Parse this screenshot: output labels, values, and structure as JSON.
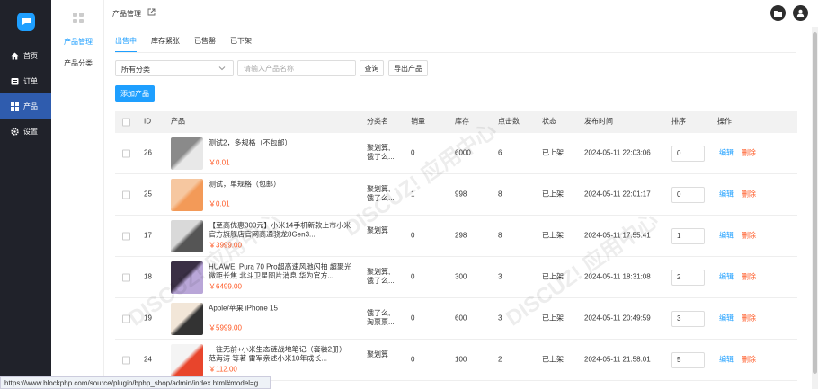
{
  "nav": [
    {
      "label": "首页",
      "icon": "home-icon"
    },
    {
      "label": "订单",
      "icon": "order-icon"
    },
    {
      "label": "产品",
      "icon": "product-icon"
    },
    {
      "label": "设置",
      "icon": "gear-icon"
    }
  ],
  "subnav": [
    "产品管理",
    "产品分类"
  ],
  "header": {
    "title": "产品管理"
  },
  "tabs": [
    "出售中",
    "库存紧张",
    "已售罄",
    "已下架"
  ],
  "filters": {
    "category_select": "所有分类",
    "search_placeholder": "请输入产品名称",
    "query_label": "查询",
    "export_label": "导出产品",
    "add_label": "添加产品"
  },
  "table": {
    "columns": [
      "ID",
      "产品",
      "分类名",
      "销量",
      "库存",
      "点击数",
      "状态",
      "发布时间",
      "排序",
      "操作"
    ],
    "rows": [
      {
        "id": "26",
        "name": "测试2，多规格（不包邮）",
        "price": "￥0.01",
        "category": "聚划算, 饿了么...",
        "sales": "0",
        "stock": "6000",
        "clicks": "6",
        "status": "已上架",
        "time": "2024-05-11 22:03:06",
        "sort": "0"
      },
      {
        "id": "25",
        "name": "测试，单规格（包邮）",
        "price": "￥0.01",
        "category": "聚划算, 饿了么...",
        "sales": "1",
        "stock": "998",
        "clicks": "8",
        "status": "已上架",
        "time": "2024-05-11 22:01:17",
        "sort": "0"
      },
      {
        "id": "17",
        "name": "【至高优惠300元】小米14手机新款上市小米官方旗舰店官网高通骁龙8Gen3...",
        "price": "￥3999.00",
        "category": "聚划算",
        "sales": "0",
        "stock": "298",
        "clicks": "8",
        "status": "已上架",
        "time": "2024-05-11 17:55:41",
        "sort": "1"
      },
      {
        "id": "18",
        "name": "HUAWEI Pura 70 Pro超高速风驰闪拍 超聚光微距长焦 北斗卫星图片消息 华为官方...",
        "price": "￥6499.00",
        "category": "聚划算, 饿了么...",
        "sales": "0",
        "stock": "300",
        "clicks": "3",
        "status": "已上架",
        "time": "2024-05-11 18:31:08",
        "sort": "2"
      },
      {
        "id": "19",
        "name": "Apple/苹果 iPhone 15",
        "price": "￥5999.00",
        "category": "饿了么, 淘票票...",
        "sales": "0",
        "stock": "600",
        "clicks": "3",
        "status": "已上架",
        "time": "2024-05-11 20:49:59",
        "sort": "3"
      },
      {
        "id": "24",
        "name": "一往无前+小米生态链战地笔记（套装2册） 范海涛 等著 雷军亲述小米10年成长...",
        "price": "￥112.00",
        "category": "聚划算",
        "sales": "0",
        "stock": "100",
        "clicks": "2",
        "status": "已上架",
        "time": "2024-05-11 21:58:01",
        "sort": "5"
      }
    ],
    "edit_label": "编辑",
    "delete_label": "删除"
  },
  "statusbar": "https://www.blockphp.com/source/plugin/bphp_shop/admin/index.html#model=g...",
  "colors": {
    "accent": "#1e9fff",
    "sidebar": "#20222a",
    "active_nav": "#2f5cae",
    "price": "#ff5722"
  }
}
